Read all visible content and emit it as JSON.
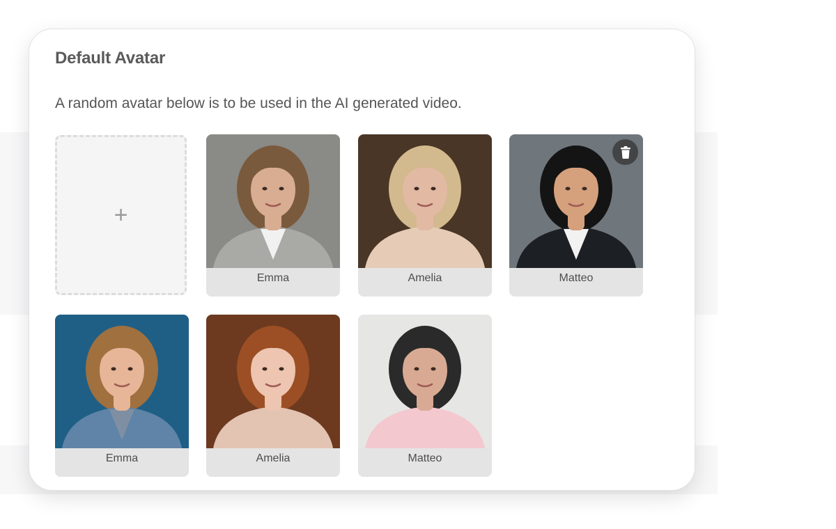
{
  "card": {
    "title": "Default Avatar",
    "description": "A random avatar below is to be used in the AI generated video."
  },
  "add_tile": {
    "icon": "plus-icon",
    "glyph": "+"
  },
  "avatars": [
    {
      "name": "Emma",
      "bg": "#8a8a86",
      "hair": "#7a5a3c",
      "skin": "#d9ad92",
      "outfit": "#a9a9a6",
      "shirt": "#f1f1f1"
    },
    {
      "name": "Amelia",
      "bg": "#4a3626",
      "hair": "#d3b98e",
      "skin": "#e2b9a3",
      "outfit": "#e6ccb6",
      "shirt": "#e6ccb6"
    },
    {
      "name": "Matteo",
      "bg": "#6f767c",
      "hair": "#141414",
      "skin": "#d5a07c",
      "outfit": "#1c1f24",
      "shirt": "#f2f2f2",
      "has_delete": true
    },
    {
      "name": "Emma",
      "bg": "#1f5f85",
      "hair": "#a0703f",
      "skin": "#e7b597",
      "outfit": "#5f84a8",
      "shirt": "#7f8fa3"
    },
    {
      "name": "Amelia",
      "bg": "#6d3a1f",
      "hair": "#9c4f25",
      "skin": "#edc5b0",
      "outfit": "#e3c3b1",
      "shirt": "#e3c3b1"
    },
    {
      "name": "Matteo",
      "bg": "#e6e6e4",
      "hair": "#2a2a2a",
      "skin": "#d9aa93",
      "outfit": "#f4c8cf",
      "shirt": "#f4c8cf"
    }
  ],
  "delete_icon": "trash-icon"
}
